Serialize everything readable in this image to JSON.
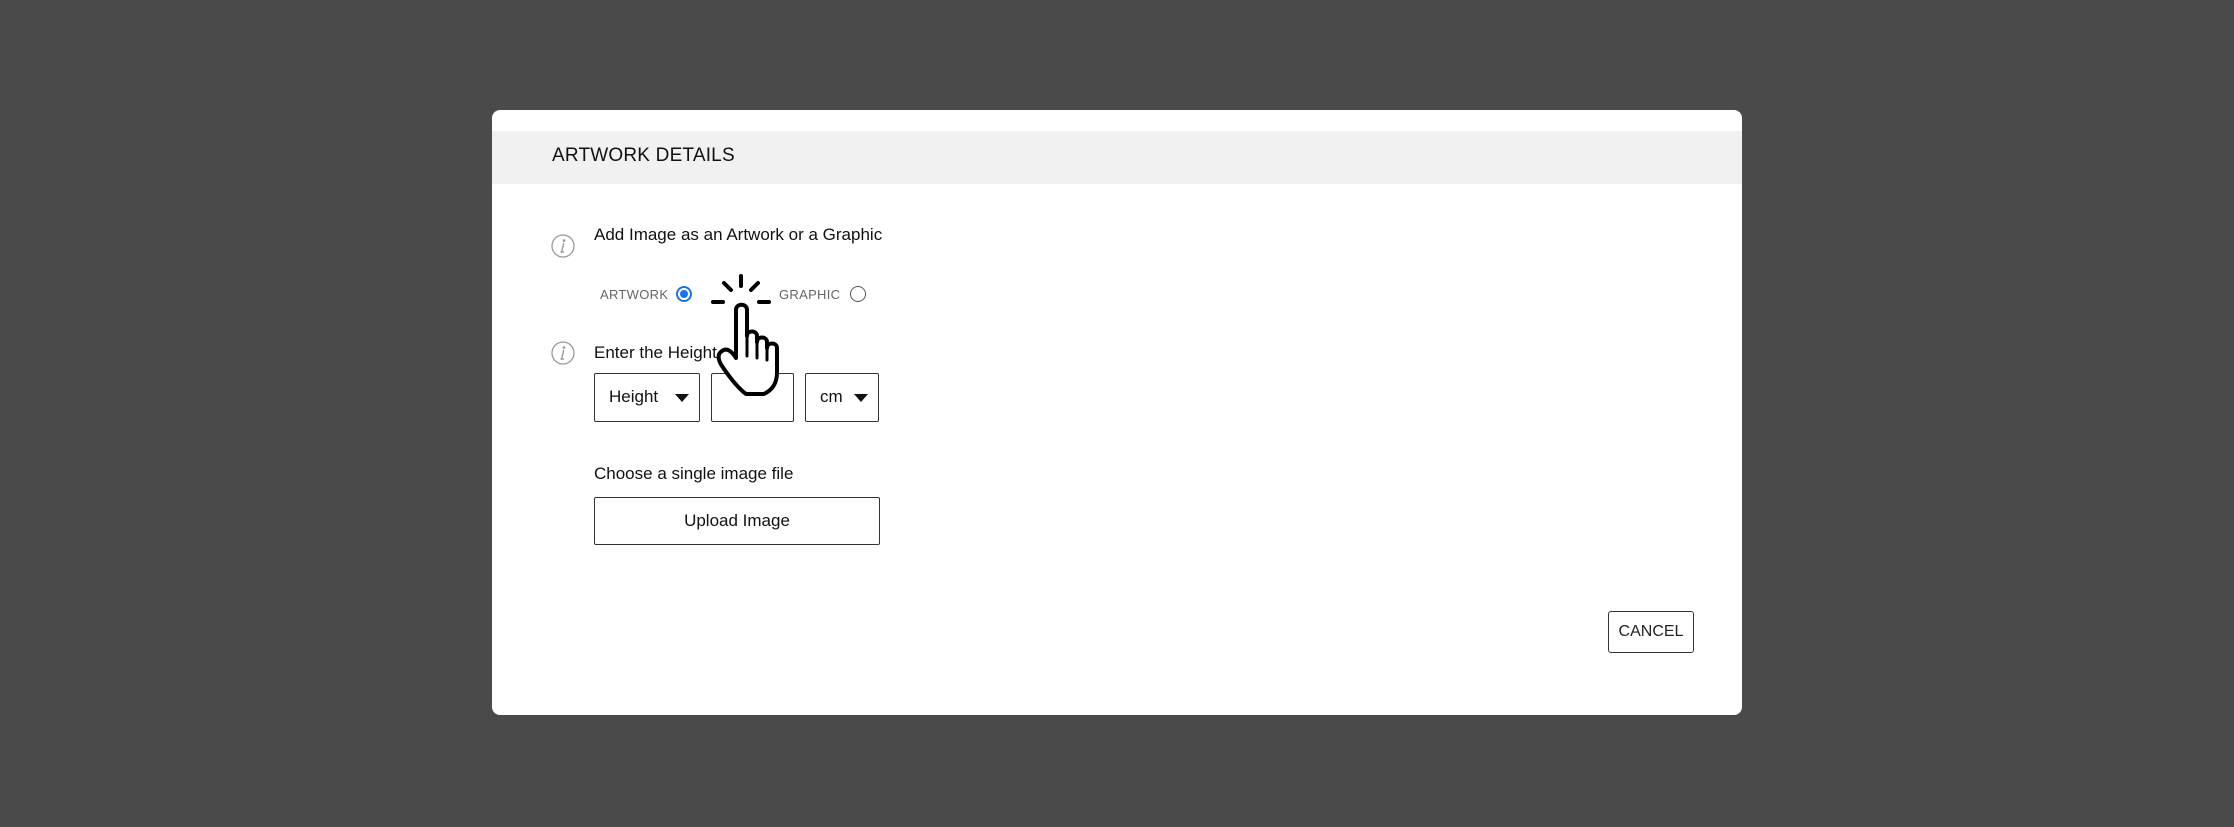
{
  "modal": {
    "title": "ARTWORK DETAILS",
    "type_section": {
      "label": "Add Image as an Artwork or a Graphic",
      "options": [
        {
          "label": "ARTWORK",
          "selected": true
        },
        {
          "label": "GRAPHIC",
          "selected": false
        }
      ]
    },
    "size_section": {
      "label": "Enter the Height",
      "dimension_select": {
        "value": "Height"
      },
      "size_input": {
        "value": ""
      },
      "unit_select": {
        "value": "cm"
      }
    },
    "upload_section": {
      "label": "Choose a single image file",
      "button_label": "Upload Image"
    },
    "cancel_label": "CANCEL"
  },
  "icons": {
    "info": "info-icon",
    "cursor": "hand-pointer-click-icon",
    "caret": "caret-down-icon"
  },
  "colors": {
    "backdrop": "#4a4a4a",
    "header_bg": "#f1f1f1",
    "radio_accent": "#1a73e8"
  }
}
